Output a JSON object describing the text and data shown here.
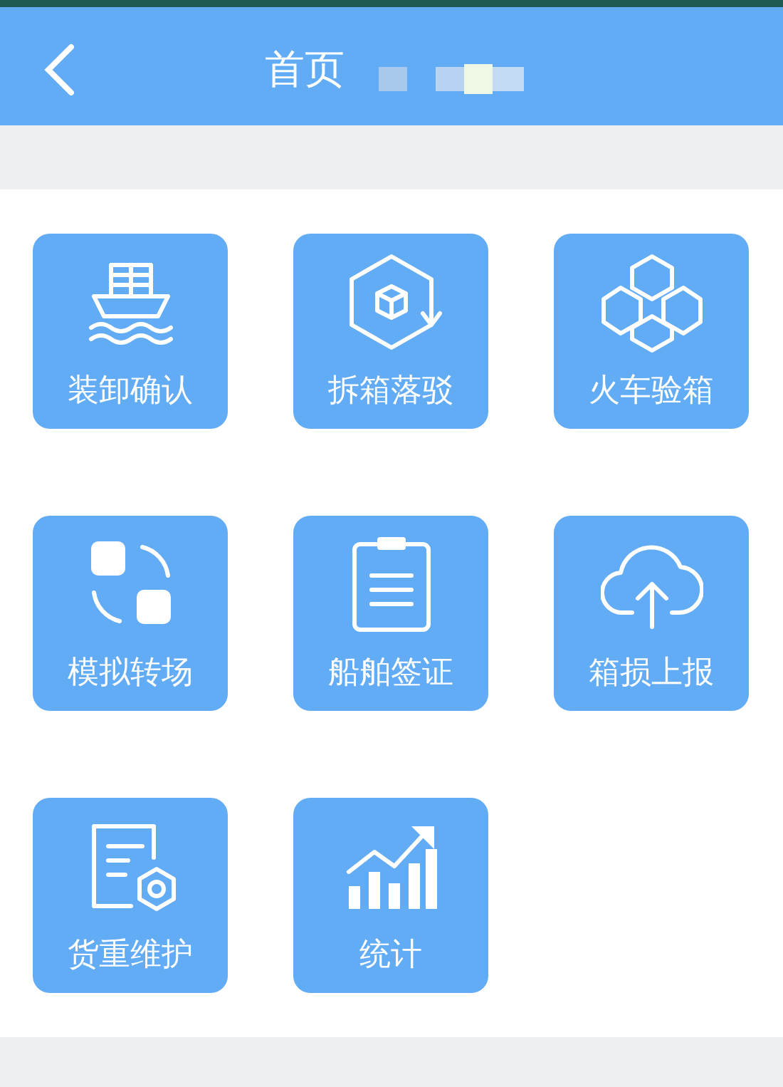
{
  "header": {
    "title": "首页"
  },
  "tiles": [
    {
      "label": "装卸确认",
      "kind": "ship"
    },
    {
      "label": "拆箱落驳",
      "kind": "hexbox"
    },
    {
      "label": "火车验箱",
      "kind": "cubes"
    },
    {
      "label": "模拟转场",
      "kind": "swap"
    },
    {
      "label": "船舶签证",
      "kind": "clipboard"
    },
    {
      "label": "箱损上报",
      "kind": "cloud"
    },
    {
      "label": "货重维护",
      "kind": "doc"
    },
    {
      "label": "统计",
      "kind": "chart"
    }
  ]
}
